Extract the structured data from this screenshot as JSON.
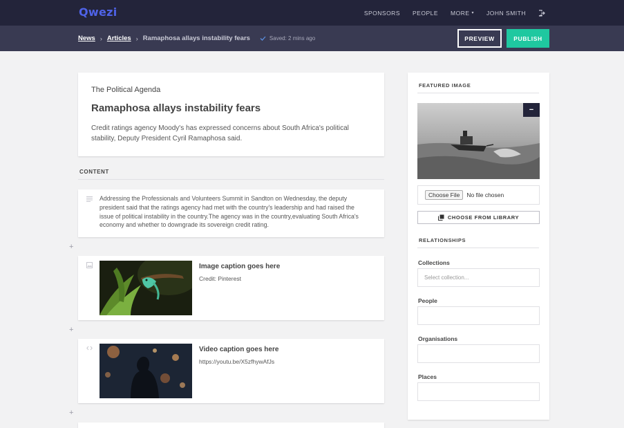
{
  "app": {
    "logo": "Qwezi"
  },
  "nav": {
    "items": [
      {
        "label": "SPONSORS"
      },
      {
        "label": "PEOPLE"
      },
      {
        "label": "MORE"
      },
      {
        "label": "JOHN SMITH"
      }
    ],
    "more_caret": "▾",
    "logout_icon": "logout-icon"
  },
  "breadcrumb": {
    "items": [
      "News",
      "Articles"
    ],
    "separator": "›",
    "current": "Ramaphosa allays instability fears",
    "saved_status": "Saved: 2 mins ago"
  },
  "actions": {
    "preview": "PREVIEW",
    "publish": "PUBLISH"
  },
  "colors": {
    "navbar": "#23243a",
    "subbar": "#393a52",
    "accent": "#1fc8a0",
    "brand": "#4f63e8"
  },
  "article": {
    "kicker": "The Political Agenda",
    "headline": "Ramaphosa allays instability fears",
    "standfirst": "Credit ratings agency Moody's has expressed concerns about South Africa's political stability, Deputy President Cyril Ramaphosa said."
  },
  "content": {
    "label": "CONTENT",
    "add_symbol": "+",
    "paragraph": "Addressing the Professionals and Volunteers Summit in Sandton on Wednesday, the deputy president said that the ratings agency had met with the country's leadership and had raised the issue of political instability in the country.The agency was in the country,evaluating South Africa's economy and whether to downgrade its sovereign credit rating.",
    "image_block": {
      "caption": "Image caption goes here",
      "credit": "Credit: Pinterest"
    },
    "video_block": {
      "caption": "Video caption goes here",
      "url": "https://youtu.be/X5zfhywAfJs"
    }
  },
  "sidebar": {
    "featured_label": "FEATURED IMAGE",
    "remove_symbol": "−",
    "file_button": "Choose File",
    "file_status": "No file chosen",
    "library_button": "CHOOSE FROM LIBRARY",
    "relationships_label": "RELATIONSHIPS",
    "collections_label": "Collections",
    "collections_placeholder": "Select collection...",
    "people_label": "People",
    "organisations_label": "Organisations",
    "places_label": "Places"
  }
}
